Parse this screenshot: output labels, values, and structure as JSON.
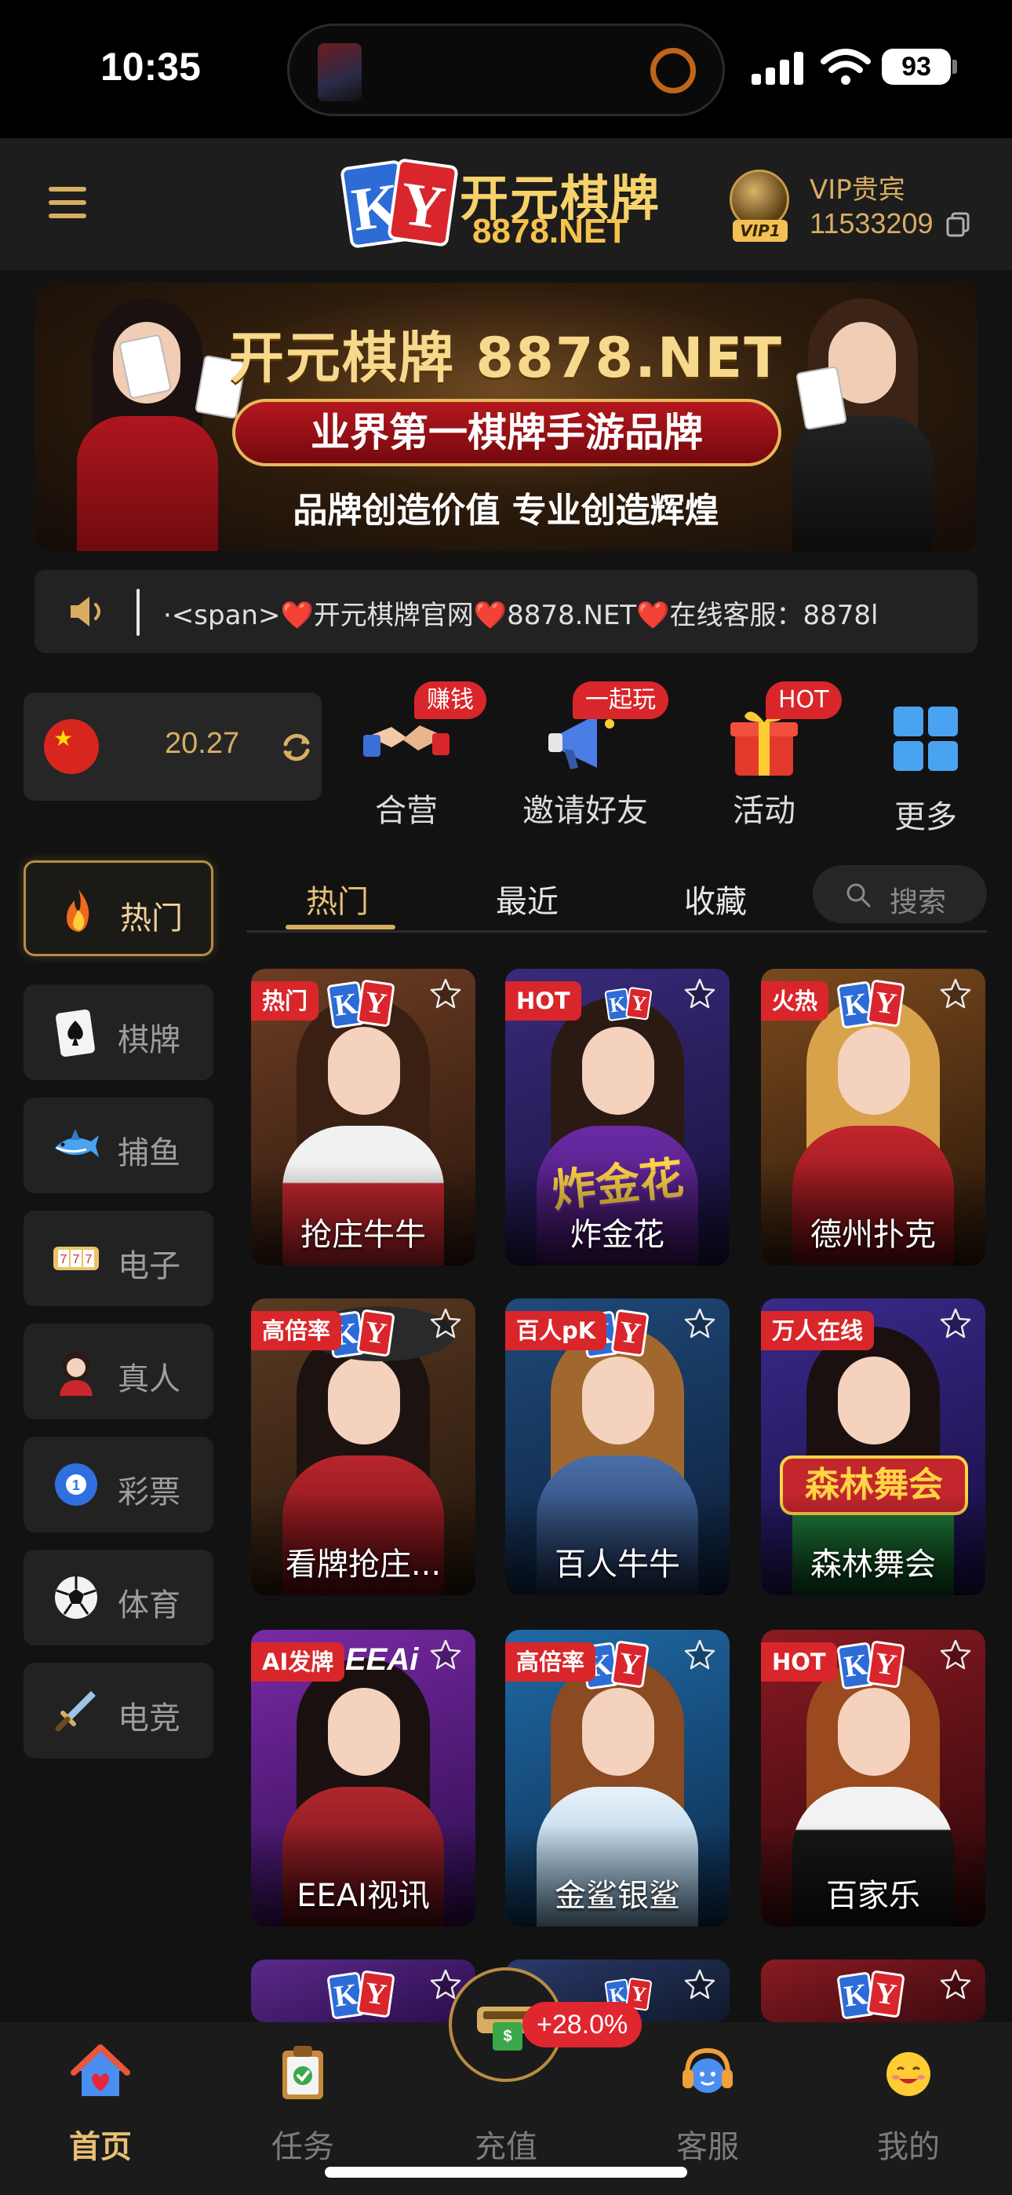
{
  "status_bar": {
    "time": "10:35",
    "battery": "93"
  },
  "header": {
    "menu_icon": "menu-icon",
    "logo_marks": [
      "K",
      "Y"
    ],
    "logo_name": "开元棋牌",
    "logo_url": "8878.NET",
    "vip_badge": "VIP1",
    "vip_level": "VIP贵宾",
    "user_id": "11533209"
  },
  "banner": {
    "title": "开元棋牌 8878.NET",
    "slogan": "业界第一棋牌手游品牌",
    "subtitle": "品牌创造价值 专业创造辉煌"
  },
  "marquee": {
    "text": "·<span>❤️开元棋牌官网❤️8878.NET❤️在线客服：8878l"
  },
  "balance": {
    "value": "20.27",
    "flag": "china-flag-icon"
  },
  "quick_actions": [
    {
      "label": "合营",
      "badge": "赚钱",
      "icon": "handshake-icon"
    },
    {
      "label": "邀请好友",
      "badge": "一起玩",
      "icon": "megaphone-icon"
    },
    {
      "label": "活动",
      "badge": "HOT",
      "icon": "gift-icon"
    },
    {
      "label": "更多",
      "badge": "",
      "icon": "grid-icon"
    }
  ],
  "categories": [
    {
      "label": "热门",
      "icon": "fire-icon",
      "active": true
    },
    {
      "label": "棋牌",
      "icon": "spade-card-icon"
    },
    {
      "label": "捕鱼",
      "icon": "shark-icon"
    },
    {
      "label": "电子",
      "icon": "slot-machine-icon"
    },
    {
      "label": "真人",
      "icon": "dealer-icon"
    },
    {
      "label": "彩票",
      "icon": "lottery-ball-icon"
    },
    {
      "label": "体育",
      "icon": "soccer-ball-icon"
    },
    {
      "label": "电竞",
      "icon": "sword-icon"
    }
  ],
  "tabs": [
    {
      "label": "热门",
      "active": true
    },
    {
      "label": "最近"
    },
    {
      "label": "收藏"
    }
  ],
  "search": {
    "placeholder": "搜索"
  },
  "games": [
    {
      "name": "抢庄牛牛",
      "tag": "热门"
    },
    {
      "name": "炸金花",
      "tag": "HOT",
      "art_text": "炸金花"
    },
    {
      "name": "德州扑克",
      "tag": "火热"
    },
    {
      "name": "看牌抢庄...",
      "tag": "高倍率"
    },
    {
      "name": "百人牛牛",
      "tag": "百人pK"
    },
    {
      "name": "森林舞会",
      "tag": "万人在线",
      "art_text": "森林舞会"
    },
    {
      "name": "EEAI视讯",
      "tag": "AI发牌",
      "art_text": "EEAi"
    },
    {
      "name": "金鲨银鲨",
      "tag": "高倍率"
    },
    {
      "name": "百家乐",
      "tag": "HOT"
    }
  ],
  "bottom_nav": [
    {
      "label": "首页",
      "icon": "home-icon",
      "active": true
    },
    {
      "label": "任务",
      "icon": "clipboard-icon"
    },
    {
      "label": "充值",
      "icon": "wallet-icon",
      "badge": "+28.0%"
    },
    {
      "label": "客服",
      "icon": "headset-icon"
    },
    {
      "label": "我的",
      "icon": "smiley-icon"
    }
  ],
  "colors": {
    "accent": "#d8ad62",
    "badge_red": "#d9262a",
    "background": "#121212"
  }
}
